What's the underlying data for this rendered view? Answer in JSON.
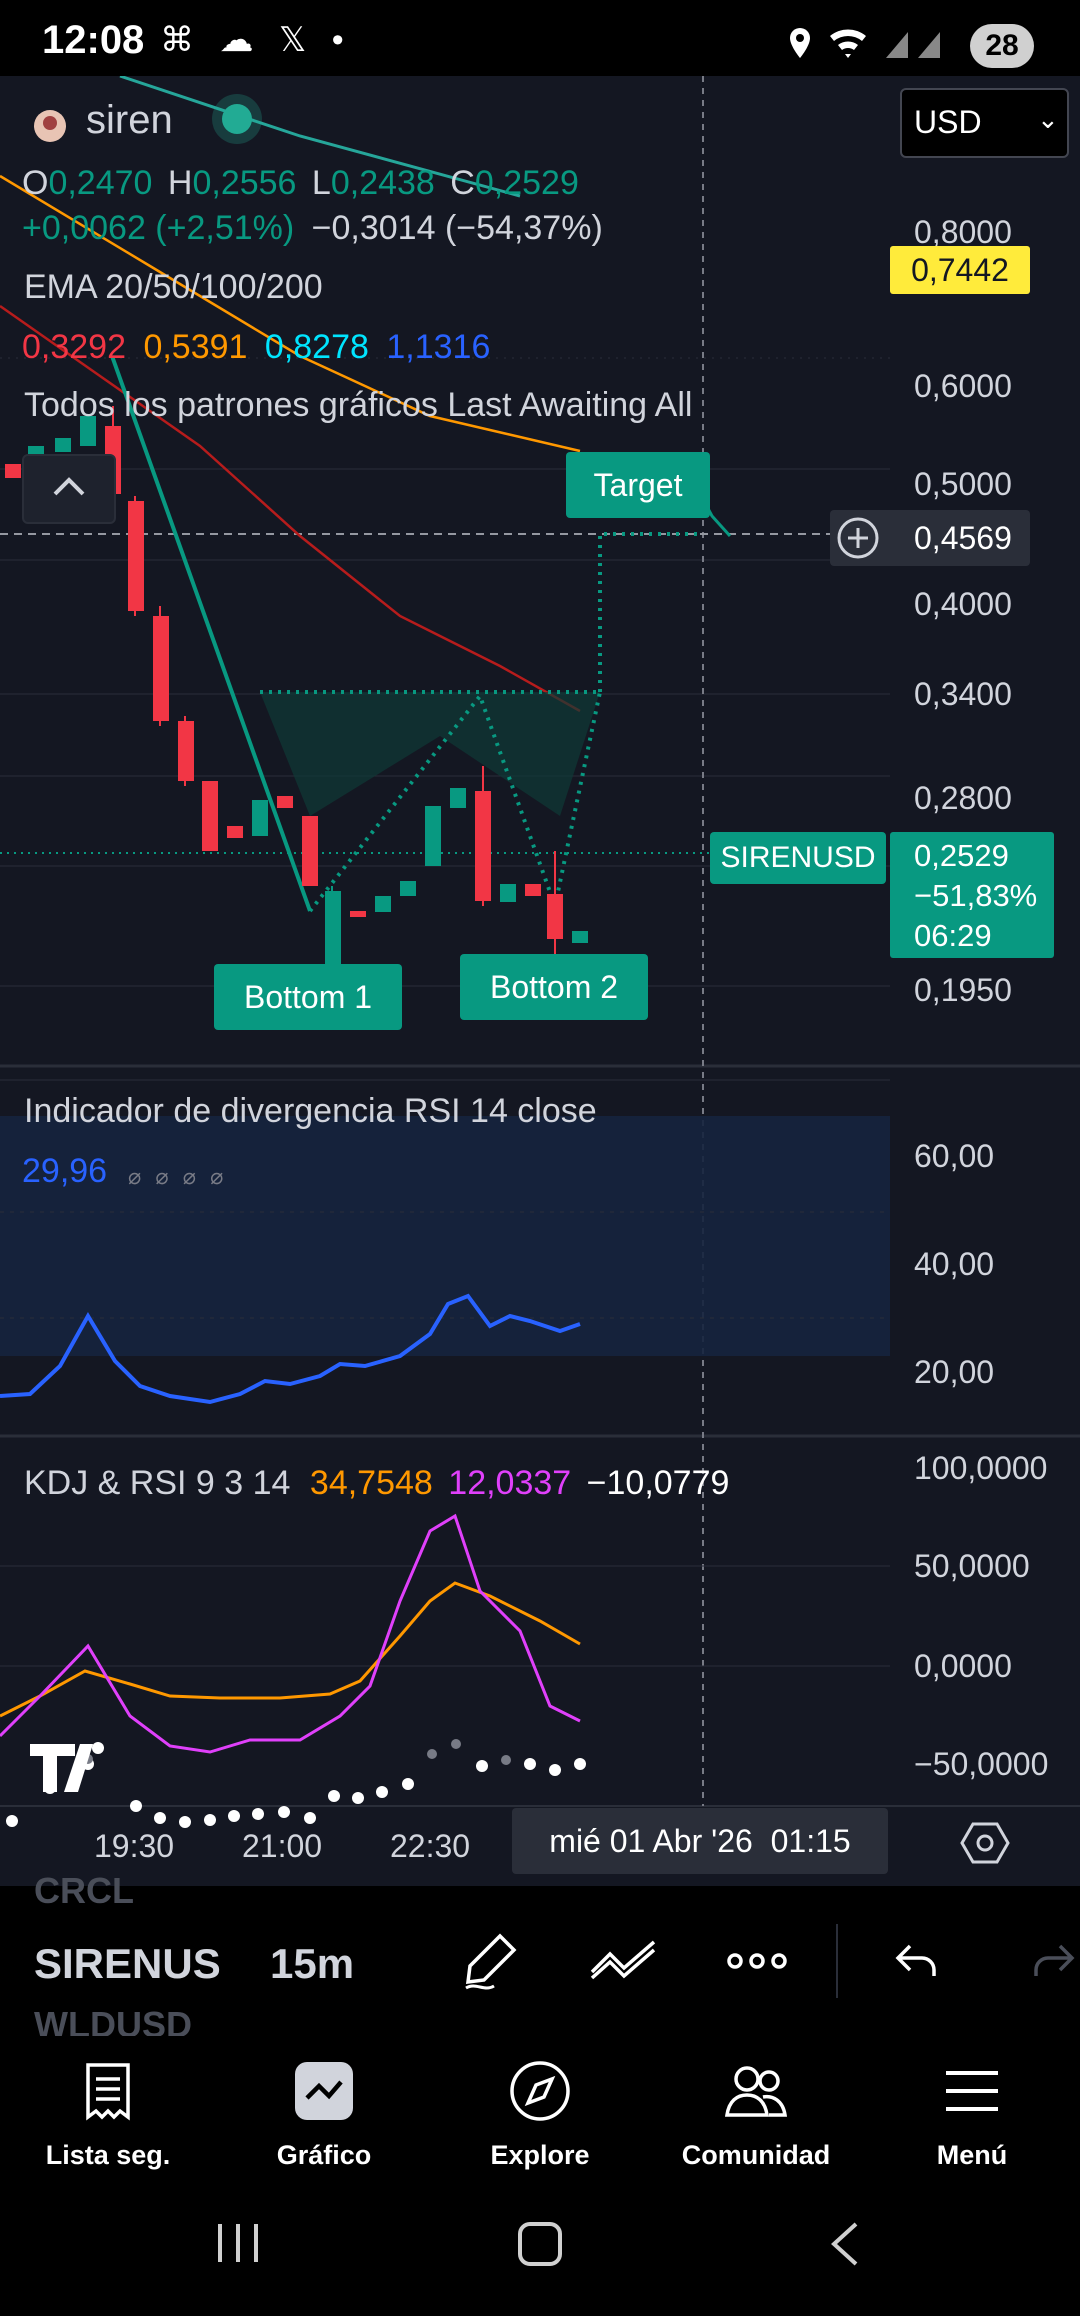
{
  "status_bar": {
    "time": "12:08",
    "icons": "⌘ ☁ 𝕏 •",
    "battery": "28"
  },
  "symbol": {
    "name": "siren",
    "currency": "USD"
  },
  "ohlc": {
    "o_label": "O",
    "o": "0,2470",
    "h_label": "H",
    "h": "0,2556",
    "l_label": "L",
    "l": "0,2438",
    "c_label": "C",
    "c": "0,2529",
    "change": "+0,0062 (+2,51%)",
    "change2": "−0,3014 (−54,37%)"
  },
  "ema": {
    "label": "EMA 20/50/100/200",
    "v20": "0,3292",
    "v50": "0,5391",
    "v100": "0,8278",
    "v200": "1,1316"
  },
  "patterns_label": "Todos los patrones gráficos Last Awaiting All",
  "price_scale": {
    "labels": [
      "0,8000",
      "0,6000",
      "0,5000",
      "0,4000",
      "0,3400",
      "0,2800",
      "0,1950"
    ],
    "highlight_yellow": "0,7442",
    "crosshair_price": "0,4569",
    "current_price": "0,2529",
    "current_change": "−51,83%",
    "countdown": "06:29",
    "ticker_tag": "SIRENUSD"
  },
  "pattern_labels": {
    "target": "Target",
    "bottom1": "Bottom 1",
    "bottom2": "Bottom 2"
  },
  "rsi": {
    "label": "Indicador de divergencia RSI 14 close",
    "value": "29,96",
    "placeholders": "⌀ ⌀ ⌀ ⌀",
    "scale": [
      "60,00",
      "40,00",
      "20,00"
    ]
  },
  "kdj": {
    "label": "KDJ & RSI 9 3 14",
    "k": "34,7548",
    "d": "12,0337",
    "j": "−10,0779",
    "scale": [
      "100,0000",
      "50,0000",
      "0,0000",
      "−50,0000"
    ]
  },
  "time_axis": {
    "labels": [
      "19:30",
      "21:00",
      "22:30"
    ],
    "crosshair_time": "mié 01 Abr '26  01:15"
  },
  "toolbar": {
    "symbol": "SIRENUS",
    "interval": "15m",
    "prev_symbol": "CRCL",
    "next_symbol": "WLDUSD"
  },
  "bottom_nav": [
    {
      "label": "Lista seg.",
      "icon": "watchlist-icon"
    },
    {
      "label": "Gráfico",
      "icon": "chart-icon"
    },
    {
      "label": "Explore",
      "icon": "compass-icon"
    },
    {
      "label": "Comunidad",
      "icon": "community-icon"
    },
    {
      "label": "Menú",
      "icon": "menu-icon"
    }
  ],
  "colors": {
    "up": "#089981",
    "down": "#f23645",
    "ema20": "#f23645",
    "ema50": "#ff9800",
    "ema100": "#00e5ff",
    "ema200": "#2962ff",
    "rsi": "#2962ff",
    "k": "#ff9800",
    "d": "#e040fb",
    "yellow": "#ffeb3b"
  }
}
